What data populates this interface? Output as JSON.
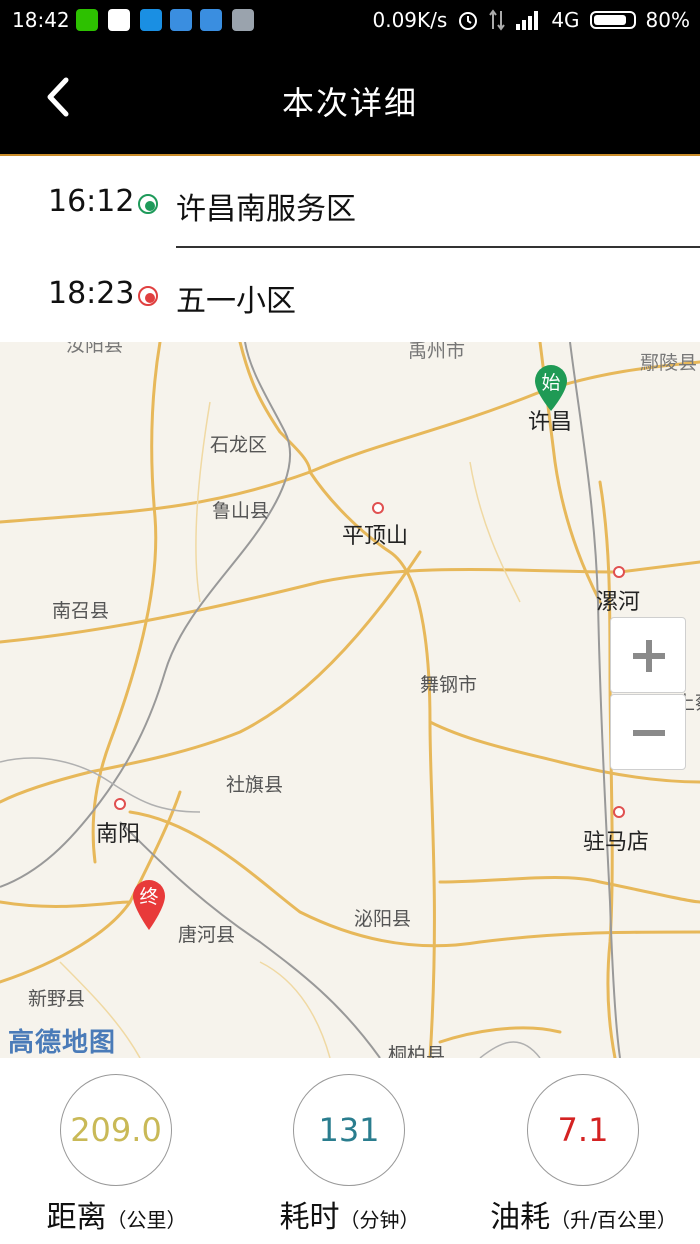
{
  "status_bar": {
    "time": "18:42",
    "network_speed": "0.09K/s",
    "network_type": "4G",
    "battery": "80%"
  },
  "header": {
    "title": "本次详细"
  },
  "route": {
    "start": {
      "time": "16:12",
      "place": "许昌南服务区",
      "color": "#1e9a5a"
    },
    "end": {
      "time": "18:23",
      "place": "五一小区",
      "color": "#e04040"
    }
  },
  "map": {
    "labels": {
      "ruyang": "汝阳县",
      "yuzhou": "禹州市",
      "yanling": "鄢陵县",
      "xuchang": "许昌",
      "shilong": "石龙区",
      "lushan": "鲁山县",
      "pingdingshan": "平顶山",
      "luohe": "漯河",
      "nanzhao": "南召县",
      "wugang": "舞钢市",
      "shangcai": "上蔡",
      "sheqi": "社旗县",
      "nanyang": "南阳",
      "zhumadian": "驻马店",
      "biyang": "泌阳县",
      "tanghe": "唐河县",
      "xinye": "新野县",
      "tongbai": "桐柏县"
    },
    "start_marker": "始",
    "end_marker": "终",
    "logo": "高德地图"
  },
  "stats": [
    {
      "value": "209.0",
      "label": "距离",
      "unit": "（公里）",
      "color": "#c9b957"
    },
    {
      "value": "131",
      "label": "耗时",
      "unit": "（分钟）",
      "color": "#2a7d8e"
    },
    {
      "value": "7.1",
      "label": "油耗",
      "unit": "（升/百公里）",
      "color": "#d42222"
    }
  ]
}
